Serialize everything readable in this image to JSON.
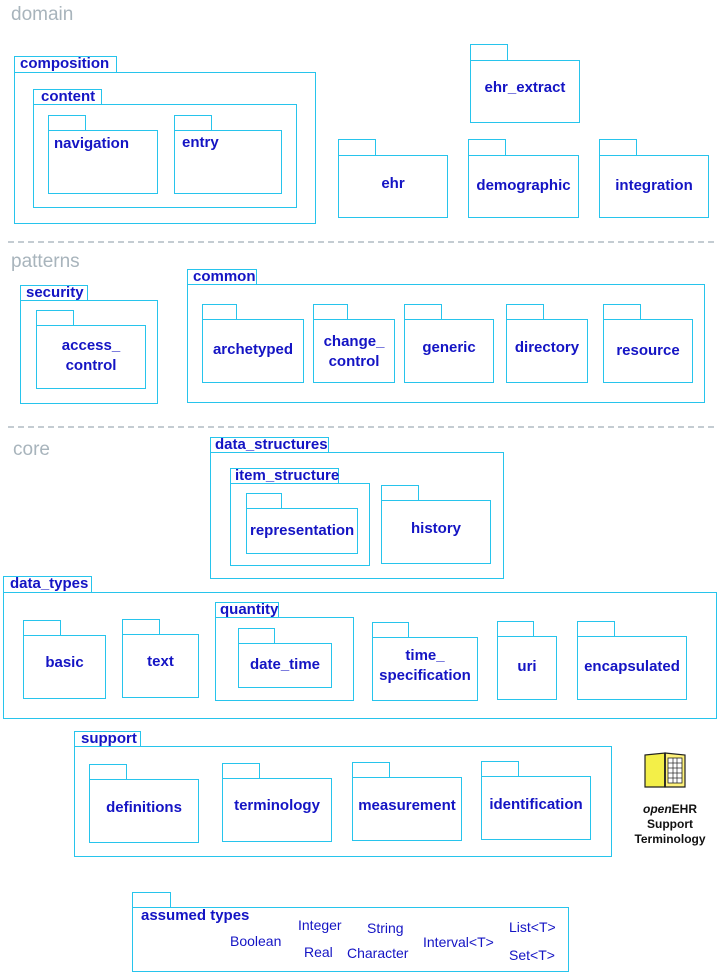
{
  "layers": {
    "domain": "domain",
    "patterns": "patterns",
    "core": "core"
  },
  "packages": {
    "composition": "composition",
    "content": "content",
    "navigation": "navigation",
    "entry": "entry",
    "ehr_extract": "ehr_extract",
    "ehr": "ehr",
    "demographic": "demographic",
    "integration": "integration",
    "security": "security",
    "access_control_line1": "access_",
    "access_control_line2": "control",
    "common": "common",
    "archetyped": "archetyped",
    "change_control_line1": "change_",
    "change_control_line2": "control",
    "generic": "generic",
    "directory": "directory",
    "resource": "resource",
    "data_structures": "data_structures",
    "item_structure": "item_structure",
    "representation": "representation",
    "history": "history",
    "data_types": "data_types",
    "basic": "basic",
    "text": "text",
    "quantity": "quantity",
    "date_time": "date_time",
    "time_specification_line1": "time_",
    "time_specification_line2": "specification",
    "uri": "uri",
    "encapsulated": "encapsulated",
    "support": "support",
    "definitions": "definitions",
    "terminology": "terminology",
    "measurement": "measurement",
    "identification": "identification",
    "assumed_types": "assumed types"
  },
  "assumed_types": {
    "boolean": "Boolean",
    "integer": "Integer",
    "real": "Real",
    "string": "String",
    "character": "Character",
    "interval": "Interval<T>",
    "list": "List<T>",
    "set": "Set<T>"
  },
  "terminology_icon": {
    "icon": "book-icon",
    "label_italic": "open",
    "label_rest": "EHR",
    "line2": "Support",
    "line3": "Terminology"
  },
  "colors": {
    "package_border": "#27c4ec",
    "package_label": "#1414c4",
    "layer_label": "#a8b4bc",
    "separator": "#c4ccd2"
  }
}
